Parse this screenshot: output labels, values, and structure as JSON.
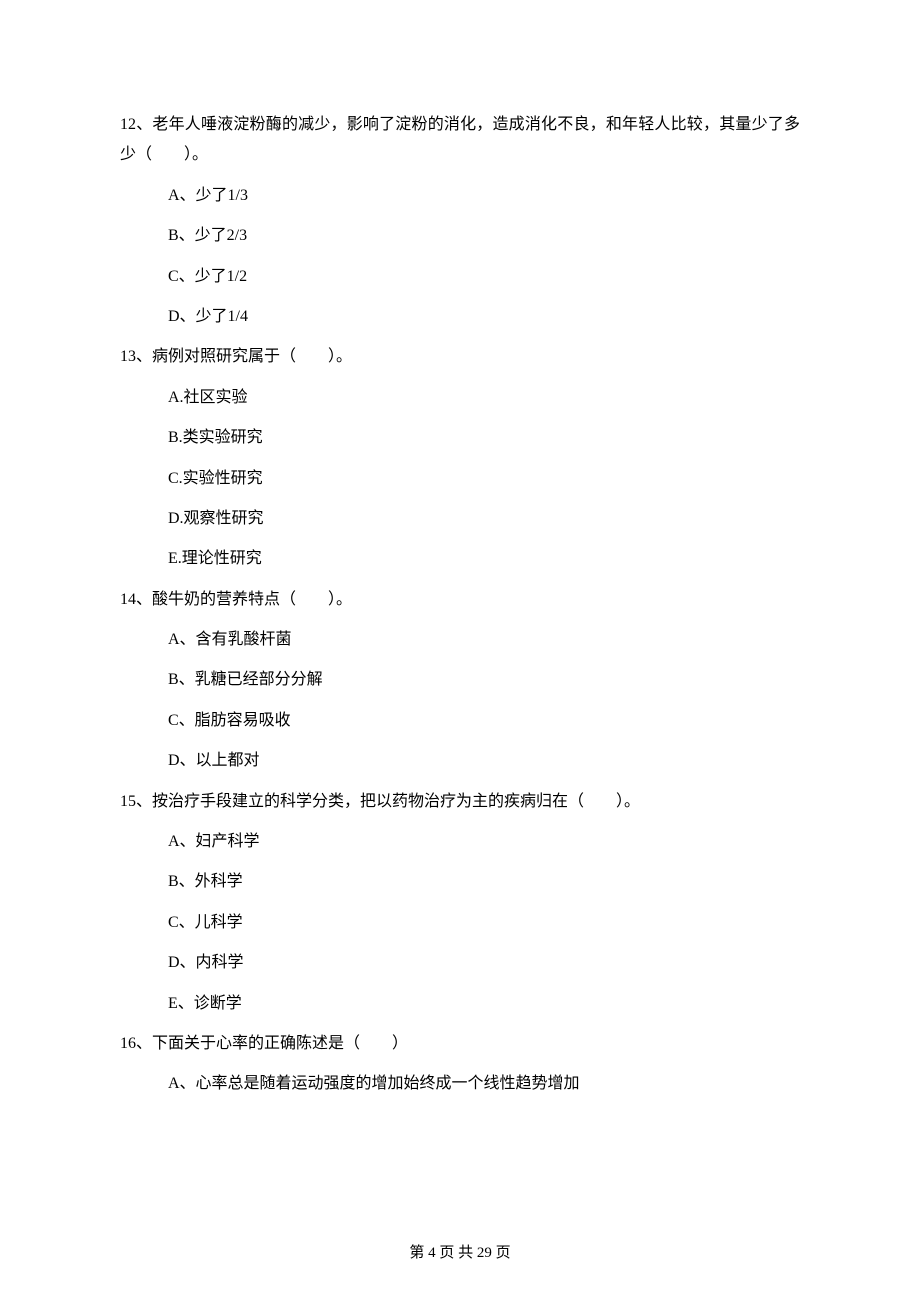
{
  "questions": [
    {
      "num": "12、",
      "text": "老年人唾液淀粉酶的减少，影响了淀粉的消化，造成消化不良，和年轻人比较，其量少了多少（　　）。",
      "options": [
        "A、少了1/3",
        "B、少了2/3",
        "C、少了1/2",
        "D、少了1/4"
      ]
    },
    {
      "num": "13、",
      "text": "病例对照研究属于（　　）。",
      "options": [
        "A.社区实验",
        "B.类实验研究",
        "C.实验性研究",
        "D.观察性研究",
        "E.理论性研究"
      ]
    },
    {
      "num": "14、",
      "text": "酸牛奶的营养特点（　　）。",
      "options": [
        "A、含有乳酸杆菌",
        "B、乳糖已经部分分解",
        "C、脂肪容易吸收",
        "D、以上都对"
      ]
    },
    {
      "num": "15、",
      "text": "按治疗手段建立的科学分类，把以药物治疗为主的疾病归在（　　）。",
      "options": [
        "A、妇产科学",
        "B、外科学",
        "C、儿科学",
        "D、内科学",
        "E、诊断学"
      ]
    },
    {
      "num": "16、",
      "text": "下面关于心率的正确陈述是（　　）",
      "options": [
        "A、心率总是随着运动强度的增加始终成一个线性趋势增加"
      ]
    }
  ],
  "footer": "第 4 页 共 29 页"
}
